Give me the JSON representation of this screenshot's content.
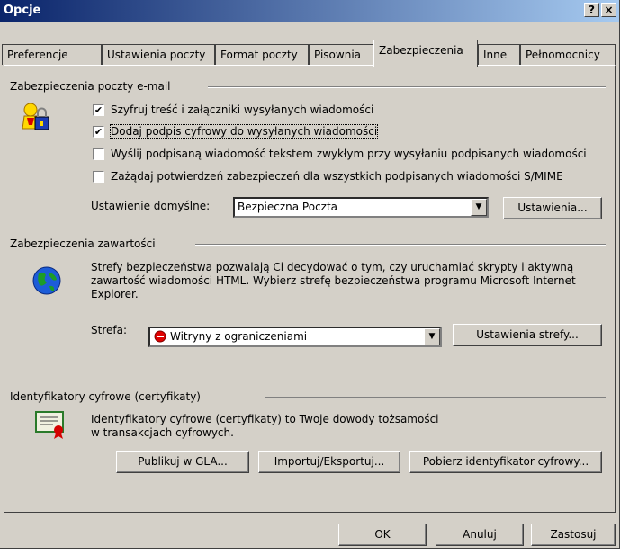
{
  "window": {
    "title": "Opcje",
    "help_btn": "?",
    "close_btn": "×"
  },
  "tabs": [
    {
      "label": "Preferencje"
    },
    {
      "label": "Ustawienia poczty"
    },
    {
      "label": "Format poczty"
    },
    {
      "label": "Pisownia"
    },
    {
      "label": "Zabezpieczenia"
    },
    {
      "label": "Inne"
    },
    {
      "label": "Pełnomocnicy"
    }
  ],
  "email_security": {
    "heading": "Zabezpieczenia poczty e-mail",
    "options": [
      {
        "label": "Szyfruj treść i załączniki wysyłanych wiadomości",
        "checked": true,
        "mark": "✔"
      },
      {
        "label": "Dodaj podpis cyfrowy do wysyłanych wiadomości",
        "checked": true,
        "mark": "✔"
      },
      {
        "label": "Wyślij podpisaną wiadomość tekstem zwykłym przy wysyłaniu podpisanych wiadomości",
        "checked": false,
        "mark": ""
      },
      {
        "label": "Zażądaj potwierdzeń zabezpieczeń dla wszystkich podpisanych wiadomości S/MIME",
        "checked": false,
        "mark": ""
      }
    ],
    "default_label": "Ustawienie domyślne:",
    "default_value": "Bezpieczna Poczta",
    "settings_btn": "Ustawienia..."
  },
  "content_security": {
    "heading": "Zabezpieczenia zawartości",
    "description_lines": [
      "Strefy bezpieczeństwa pozwalają Ci decydować o tym, czy uruchamiać skrypty i aktywną",
      "zawartość wiadomości HTML. Wybierz strefę bezpieczeństwa programu Microsoft Internet",
      "Explorer."
    ],
    "zone_label": "Strefa:",
    "zone_value": "Witryny z ograniczeniami",
    "zone_settings_btn": "Ustawienia strefy..."
  },
  "digital_ids": {
    "heading": "Identyfikatory cyfrowe (certyfikaty)",
    "description_lines": [
      "Identyfikatory cyfrowe (certyfikaty) to Twoje dowody tożsamości",
      "w transakcjach cyfrowych."
    ],
    "publish_btn": "Publikuj w GLA...",
    "import_btn": "Importuj/Eksportuj...",
    "get_btn": "Pobierz identyfikator cyfrowy..."
  },
  "footer": {
    "ok": "OK",
    "cancel": "Anuluj",
    "apply": "Zastosuj"
  }
}
